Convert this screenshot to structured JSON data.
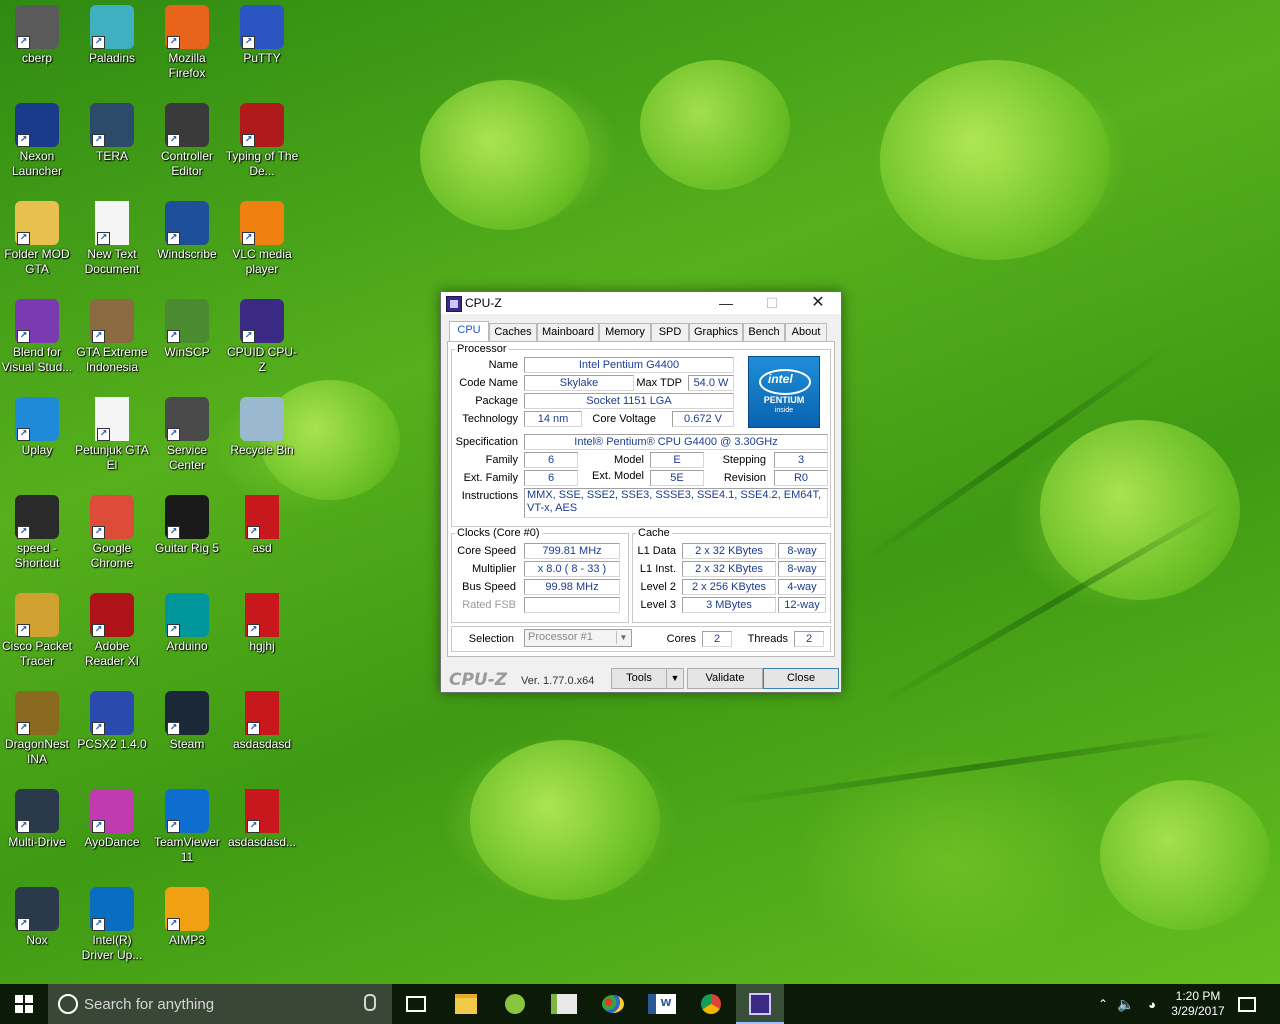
{
  "desktop": {
    "icons": [
      {
        "label": "cberp",
        "icon": "cbe-icon",
        "bg": "#5a5a5a"
      },
      {
        "label": "Paladins",
        "icon": "paladins-icon",
        "bg": "#3fb0c0"
      },
      {
        "label": "Mozilla Firefox",
        "icon": "firefox-icon",
        "bg": "#e8641b"
      },
      {
        "label": "PuTTY",
        "icon": "putty-icon",
        "bg": "#2a55c0"
      },
      {
        "label": "Nexon Launcher",
        "icon": "nexon-icon",
        "bg": "#1b3a8a"
      },
      {
        "label": "TERA",
        "icon": "tera-icon",
        "bg": "#2c4a6a"
      },
      {
        "label": "Controller Editor",
        "icon": "controller-icon",
        "bg": "#3a3a3a"
      },
      {
        "label": "Typing of The De...",
        "icon": "typing-dead-icon",
        "bg": "#b01a1a"
      },
      {
        "label": "Folder MOD GTA",
        "icon": "folder-icon",
        "bg": "#e8c050"
      },
      {
        "label": "New Text Document",
        "icon": "text-document-icon",
        "bg": "#f5f5f5"
      },
      {
        "label": "Windscribe",
        "icon": "windscribe-icon",
        "bg": "#1d4f9a"
      },
      {
        "label": "VLC media player",
        "icon": "vlc-icon",
        "bg": "#f08010"
      },
      {
        "label": "Blend for Visual Stud...",
        "icon": "blend-icon",
        "bg": "#7a3ab0"
      },
      {
        "label": "GTA Extreme Indonesia",
        "icon": "gta-icon",
        "bg": "#8a6a40"
      },
      {
        "label": "WinSCP",
        "icon": "winscp-icon",
        "bg": "#4a8a30"
      },
      {
        "label": "CPUID CPU-Z",
        "icon": "cpuz-icon",
        "bg": "#3a2a86"
      },
      {
        "label": "Uplay",
        "icon": "uplay-icon",
        "bg": "#1e8ad8"
      },
      {
        "label": "Petunjuk GTA El",
        "icon": "text-document-icon",
        "bg": "#f5f5f5"
      },
      {
        "label": "Service Center",
        "icon": "service-center-icon",
        "bg": "#4a4a4a"
      },
      {
        "label": "Recycle Bin",
        "icon": "recycle-bin-icon",
        "bg": "#9ab8d0"
      },
      {
        "label": "speed - Shortcut",
        "icon": "nfs-icon",
        "bg": "#2a2a2a"
      },
      {
        "label": "Google Chrome",
        "icon": "chrome-icon",
        "bg": "#dd4b39"
      },
      {
        "label": "Guitar Rig 5",
        "icon": "guitar-rig-icon",
        "bg": "#1a1a1a"
      },
      {
        "label": "asd",
        "icon": "pdf-icon",
        "bg": "#c8181e"
      },
      {
        "label": "Cisco Packet Tracer",
        "icon": "packet-tracer-icon",
        "bg": "#d0a030"
      },
      {
        "label": "Adobe Reader XI",
        "icon": "adobe-reader-icon",
        "bg": "#b0121a"
      },
      {
        "label": "Arduino",
        "icon": "arduino-icon",
        "bg": "#00979c"
      },
      {
        "label": "hgjhj",
        "icon": "pdf-icon",
        "bg": "#c8181e"
      },
      {
        "label": "DragonNest INA",
        "icon": "dragonnest-icon",
        "bg": "#8a6a20"
      },
      {
        "label": "PCSX2 1.4.0",
        "icon": "pcsx2-icon",
        "bg": "#2a4ab0"
      },
      {
        "label": "Steam",
        "icon": "steam-icon",
        "bg": "#1b2838"
      },
      {
        "label": "asdasdasd",
        "icon": "pdf-icon",
        "bg": "#c8181e"
      },
      {
        "label": "Multi-Drive",
        "icon": "nox-icon",
        "bg": "#2a3a4a"
      },
      {
        "label": "AyoDance",
        "icon": "ayodance-icon",
        "bg": "#c03ab0"
      },
      {
        "label": "TeamViewer 11",
        "icon": "teamviewer-icon",
        "bg": "#0e6ed0"
      },
      {
        "label": "asdasdasd...",
        "icon": "pdf-icon",
        "bg": "#c8181e"
      },
      {
        "label": "Nox",
        "icon": "nox-icon",
        "bg": "#2a3a4a"
      },
      {
        "label": "Intel(R) Driver Up...",
        "icon": "intel-icon",
        "bg": "#0a6ec0"
      },
      {
        "label": "AIMP3",
        "icon": "aimp-icon",
        "bg": "#f0a010"
      }
    ]
  },
  "cpuz": {
    "title": "CPU-Z",
    "tabs": [
      "CPU",
      "Caches",
      "Mainboard",
      "Memory",
      "SPD",
      "Graphics",
      "Bench",
      "About"
    ],
    "processor": {
      "group_label": "Processor",
      "name_label": "Name",
      "name": "Intel Pentium G4400",
      "codename_label": "Code Name",
      "codename": "Skylake",
      "maxtdp_label": "Max TDP",
      "maxtdp": "54.0 W",
      "package_label": "Package",
      "package": "Socket 1151 LGA",
      "technology_label": "Technology",
      "technology": "14 nm",
      "corevoltage_label": "Core Voltage",
      "corevoltage": "0.672 V",
      "spec_label": "Specification",
      "spec": "Intel® Pentium® CPU G4400 @ 3.30GHz",
      "family_label": "Family",
      "family": "6",
      "model_label": "Model",
      "model": "E",
      "stepping_label": "Stepping",
      "stepping": "3",
      "extfamily_label": "Ext. Family",
      "extfamily": "6",
      "extmodel_label": "Ext. Model",
      "extmodel": "5E",
      "revision_label": "Revision",
      "revision": "R0",
      "instructions_label": "Instructions",
      "instructions": "MMX, SSE, SSE2, SSE3, SSSE3, SSE4.1, SSE4.2, EM64T, VT-x, AES",
      "logo_brand": "intel",
      "logo_product": "PENTIUM",
      "logo_inside": "inside"
    },
    "clocks": {
      "group_label": "Clocks (Core #0)",
      "corespeed_label": "Core Speed",
      "corespeed": "799.81 MHz",
      "multiplier_label": "Multiplier",
      "multiplier": "x 8.0 ( 8 - 33 )",
      "busspeed_label": "Bus Speed",
      "busspeed": "99.98 MHz",
      "ratedfsb_label": "Rated FSB",
      "ratedfsb": ""
    },
    "cache": {
      "group_label": "Cache",
      "l1data_label": "L1 Data",
      "l1data": "2 x 32 KBytes",
      "l1data_way": "8-way",
      "l1inst_label": "L1 Inst.",
      "l1inst": "2 x 32 KBytes",
      "l1inst_way": "8-way",
      "l2_label": "Level 2",
      "l2": "2 x 256 KBytes",
      "l2_way": "4-way",
      "l3_label": "Level 3",
      "l3": "3 MBytes",
      "l3_way": "12-way"
    },
    "selection": {
      "label": "Selection",
      "value": "Processor #1",
      "cores_label": "Cores",
      "cores": "2",
      "threads_label": "Threads",
      "threads": "2"
    },
    "footer": {
      "logo": "CPU-Z",
      "version": "Ver. 1.77.0.x64",
      "tools": "Tools",
      "validate": "Validate",
      "close": "Close"
    }
  },
  "taskbar": {
    "search_placeholder": "Search for anything",
    "time": "1:20 PM",
    "date": "3/29/2017"
  }
}
